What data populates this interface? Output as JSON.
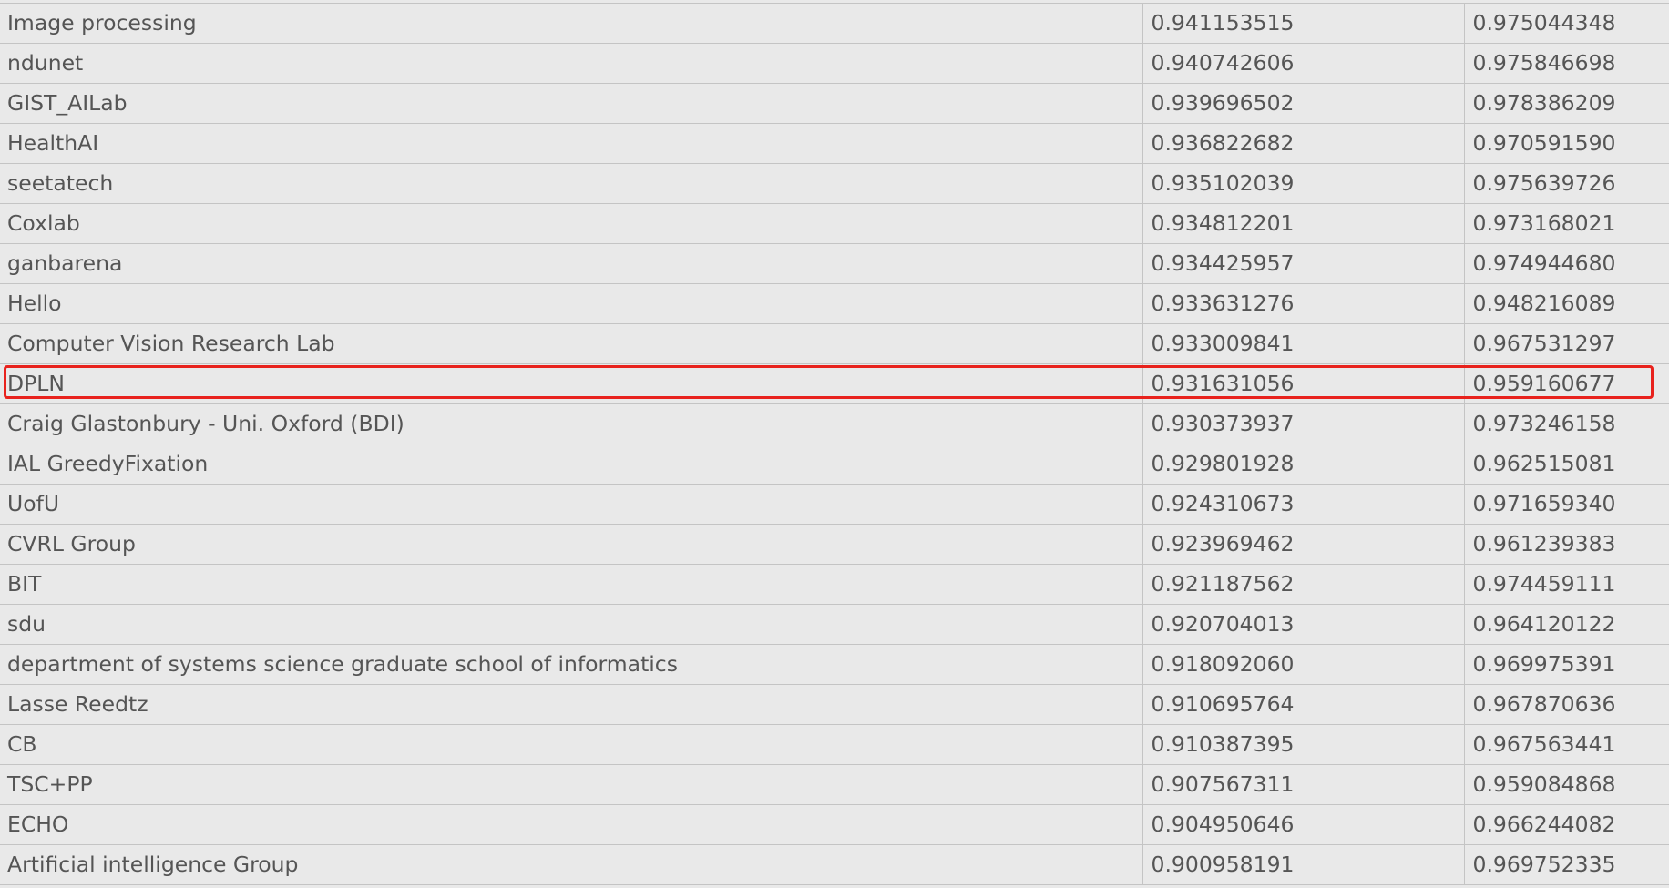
{
  "table": {
    "rows": [
      {
        "team": "Image processing",
        "score1": "0.941153515",
        "score2": "0.975044348"
      },
      {
        "team": "ndunet",
        "score1": "0.940742606",
        "score2": "0.975846698"
      },
      {
        "team": "GIST_AILab",
        "score1": "0.939696502",
        "score2": "0.978386209"
      },
      {
        "team": "HealthAI",
        "score1": "0.936822682",
        "score2": "0.970591590"
      },
      {
        "team": "seetatech",
        "score1": "0.935102039",
        "score2": "0.975639726"
      },
      {
        "team": "Coxlab",
        "score1": "0.934812201",
        "score2": "0.973168021"
      },
      {
        "team": "ganbarena",
        "score1": "0.934425957",
        "score2": "0.974944680"
      },
      {
        "team": "Hello",
        "score1": "0.933631276",
        "score2": "0.948216089"
      },
      {
        "team": "Computer Vision Research Lab",
        "score1": "0.933009841",
        "score2": "0.967531297"
      },
      {
        "team": "DPLN",
        "score1": "0.931631056",
        "score2": "0.959160677"
      },
      {
        "team": "Craig Glastonbury - Uni. Oxford (BDI)",
        "score1": "0.930373937",
        "score2": "0.973246158"
      },
      {
        "team": "IAL GreedyFixation",
        "score1": "0.929801928",
        "score2": "0.962515081"
      },
      {
        "team": "UofU",
        "score1": "0.924310673",
        "score2": "0.971659340"
      },
      {
        "team": "CVRL Group",
        "score1": "0.923969462",
        "score2": "0.961239383"
      },
      {
        "team": "BIT",
        "score1": "0.921187562",
        "score2": "0.974459111"
      },
      {
        "team": "sdu",
        "score1": "0.920704013",
        "score2": "0.964120122"
      },
      {
        "team": "department of systems science graduate school of informatics",
        "score1": "0.918092060",
        "score2": "0.969975391"
      },
      {
        "team": "Lasse Reedtz",
        "score1": "0.910695764",
        "score2": "0.967870636"
      },
      {
        "team": "CB",
        "score1": "0.910387395",
        "score2": "0.967563441"
      },
      {
        "team": "TSC+PP",
        "score1": "0.907567311",
        "score2": "0.959084868"
      },
      {
        "team": "ECHO",
        "score1": "0.904950646",
        "score2": "0.966244082"
      },
      {
        "team": "Artificial intelligence Group",
        "score1": "0.900958191",
        "score2": "0.969752335"
      }
    ],
    "highlighted_team": "DPLN"
  },
  "colors": {
    "background": "#e9e9e9",
    "text": "#555555",
    "grid": "#c4c4c4",
    "highlight": "#e8221d"
  }
}
